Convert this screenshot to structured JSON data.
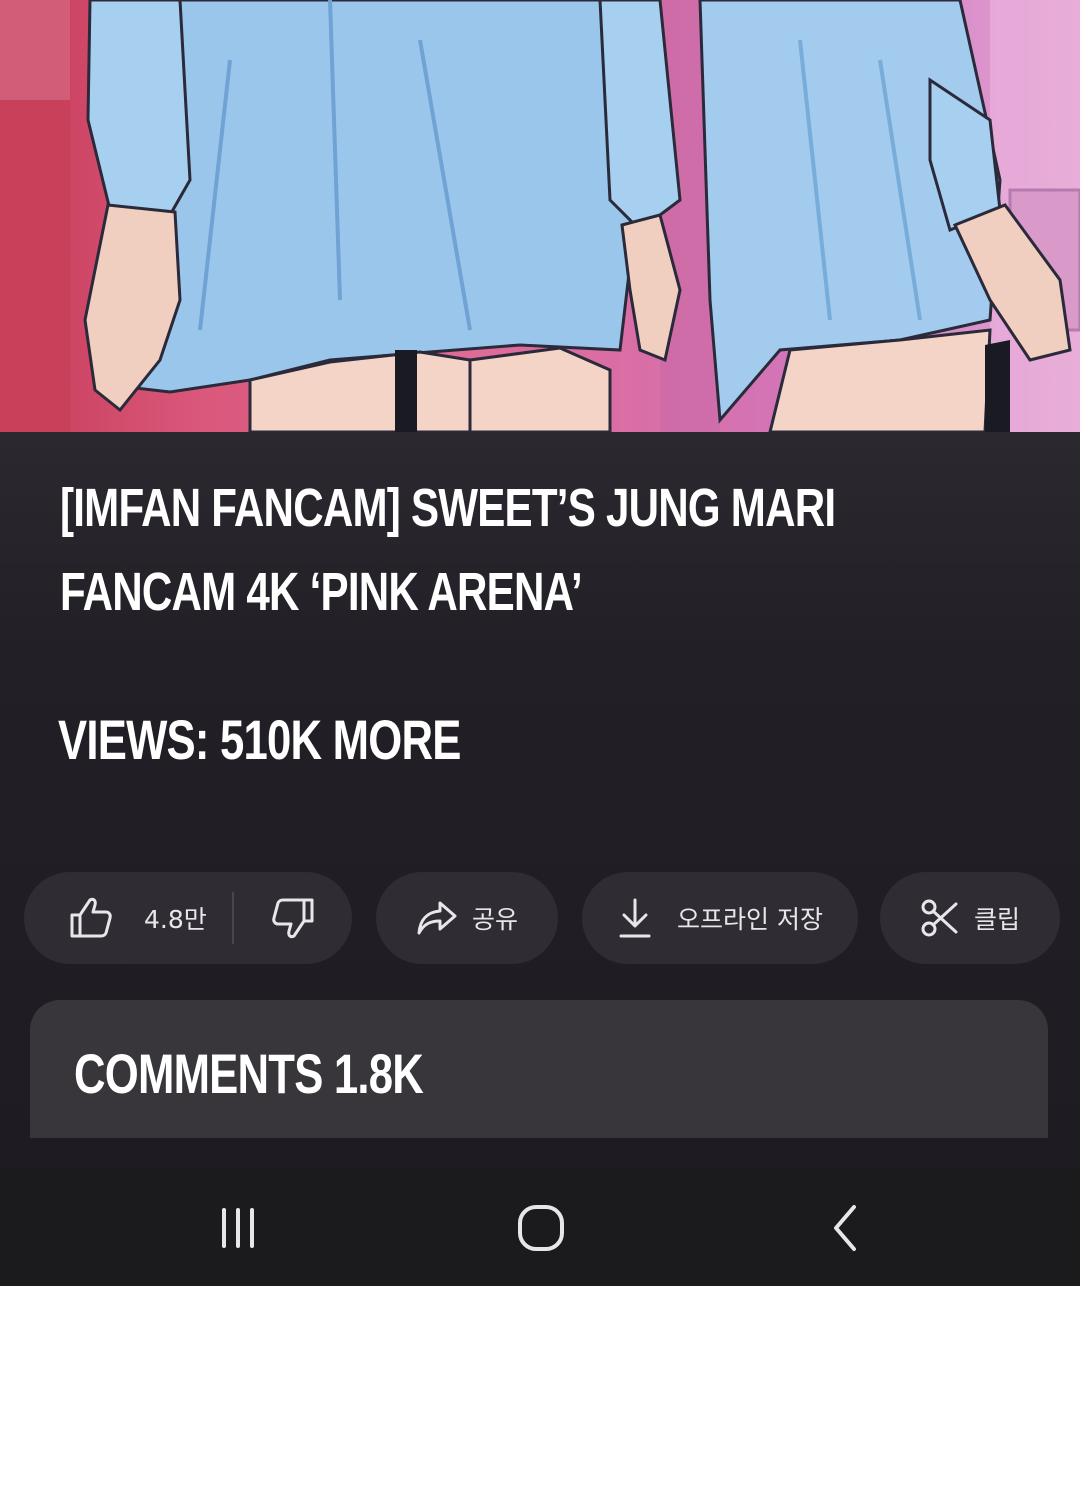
{
  "video": {
    "thumbnail_icon": "anime-illustration-image"
  },
  "title": "[IMFAN FANCAM] SWEET’S JUNG MARI FANCAM 4K ‘PINK ARENA’",
  "views_text": "VIEWS: 510K MORE",
  "actions": {
    "like_icon": "thumbs-up-icon",
    "like_count": "4.8만",
    "dislike_icon": "thumbs-down-icon",
    "share_icon": "share-arrow-icon",
    "share_label": "공유",
    "download_icon": "download-icon",
    "download_label": "오프라인 저장",
    "clip_icon": "scissors-icon",
    "clip_label": "클립"
  },
  "comments": {
    "title": "COMMENTS 1.8K"
  },
  "nav_bar": {
    "recent_icon": "recent-apps-icon",
    "home_icon": "home-icon",
    "back_icon": "back-icon"
  },
  "colors": {
    "panel_bg": "#231f27",
    "pill_bg": "#2f2c33",
    "card_bg": "#38353b",
    "nav_bg": "#1b1a1d",
    "text": "#ffffff"
  }
}
